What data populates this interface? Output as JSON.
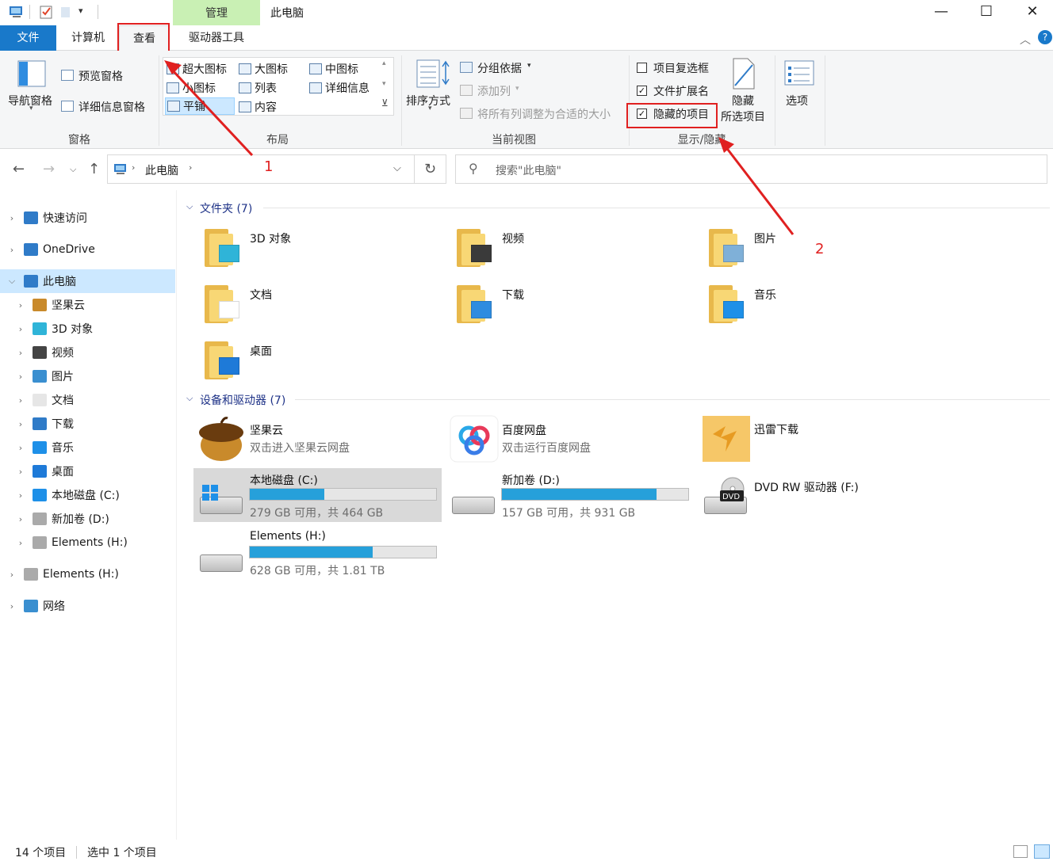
{
  "window": {
    "title": "此电脑",
    "contextual_tab": "管理",
    "minimize": "—",
    "maximize": "☐",
    "close": "✕"
  },
  "tabs": {
    "file": "文件",
    "computer": "计算机",
    "view": "查看",
    "drive_tools": "驱动器工具"
  },
  "ribbon": {
    "panes": {
      "nav_pane": "导航窗格",
      "preview_pane": "预览窗格",
      "details_pane": "详细信息窗格",
      "label": "窗格"
    },
    "layout": {
      "label": "布局",
      "items": [
        "超大图标",
        "大图标",
        "中图标",
        "小图标",
        "列表",
        "详细信息",
        "平铺",
        "内容"
      ]
    },
    "current_view": {
      "label": "当前视图",
      "sort_by": "排序方式",
      "group_by": "分组依据",
      "add_column": "添加列",
      "fit_columns": "将所有列调整为合适的大小"
    },
    "show_hide": {
      "label": "显示/隐藏",
      "item_checkboxes": "项目复选框",
      "file_extensions": "文件扩展名",
      "hidden_items": "隐藏的项目",
      "item_checkboxes_checked": false,
      "file_extensions_checked": true,
      "hidden_items_checked": true,
      "hide_selected_line1": "隐藏",
      "hide_selected_line2": "所选项目"
    },
    "options": "选项"
  },
  "address": {
    "path": "此电脑",
    "search_placeholder": "搜索\"此电脑\""
  },
  "nav": [
    {
      "label": "快速访问",
      "level": 0,
      "icon": "star-icon"
    },
    {
      "label": "OneDrive",
      "level": 0,
      "icon": "cloud-icon"
    },
    {
      "label": "此电脑",
      "level": 0,
      "icon": "computer-icon",
      "selected": true,
      "expanded": true
    },
    {
      "label": "坚果云",
      "level": 1,
      "icon": "nut-icon"
    },
    {
      "label": "3D 对象",
      "level": 1,
      "icon": "cube-icon"
    },
    {
      "label": "视频",
      "level": 1,
      "icon": "film-icon"
    },
    {
      "label": "图片",
      "level": 1,
      "icon": "picture-icon"
    },
    {
      "label": "文档",
      "level": 1,
      "icon": "document-icon"
    },
    {
      "label": "下载",
      "level": 1,
      "icon": "download-icon"
    },
    {
      "label": "音乐",
      "level": 1,
      "icon": "music-icon"
    },
    {
      "label": "桌面",
      "level": 1,
      "icon": "desktop-icon"
    },
    {
      "label": "本地磁盘 (C:)",
      "level": 1,
      "icon": "windows-drive-icon"
    },
    {
      "label": "新加卷 (D:)",
      "level": 1,
      "icon": "drive-icon"
    },
    {
      "label": "Elements (H:)",
      "level": 1,
      "icon": "drive-icon"
    },
    {
      "label": "Elements (H:)",
      "level": 0,
      "icon": "drive-icon"
    },
    {
      "label": "网络",
      "level": 0,
      "icon": "network-icon"
    }
  ],
  "folders": {
    "header": "文件夹 (7)",
    "items": [
      "3D 对象",
      "视频",
      "图片",
      "文档",
      "下载",
      "音乐",
      "桌面"
    ]
  },
  "devices": {
    "header": "设备和驱动器 (7)",
    "apps": [
      {
        "name": "坚果云",
        "desc": "双击进入坚果云网盘"
      },
      {
        "name": "百度网盘",
        "desc": "双击运行百度网盘"
      },
      {
        "name": "迅雷下载",
        "desc": ""
      }
    ],
    "drives": [
      {
        "name": "本地磁盘 (C:)",
        "info": "279 GB 可用，共 464 GB",
        "used_fraction": 0.399
      },
      {
        "name": "新加卷 (D:)",
        "info": "157 GB 可用，共 931 GB",
        "used_fraction": 0.831
      },
      {
        "name": "DVD RW 驱动器 (F:)",
        "info": ""
      },
      {
        "name": "Elements (H:)",
        "info": "628 GB 可用，共 1.81 TB",
        "used_fraction": 0.661
      }
    ]
  },
  "status": {
    "count": "14 个项目",
    "selected": "选中 1 个项目"
  },
  "annotations": {
    "one": "1",
    "two": "2"
  },
  "colors": {
    "accent": "#1979ca",
    "highlight": "#e02020",
    "bar": "#26a0da",
    "manage": "#c9f0b4"
  }
}
